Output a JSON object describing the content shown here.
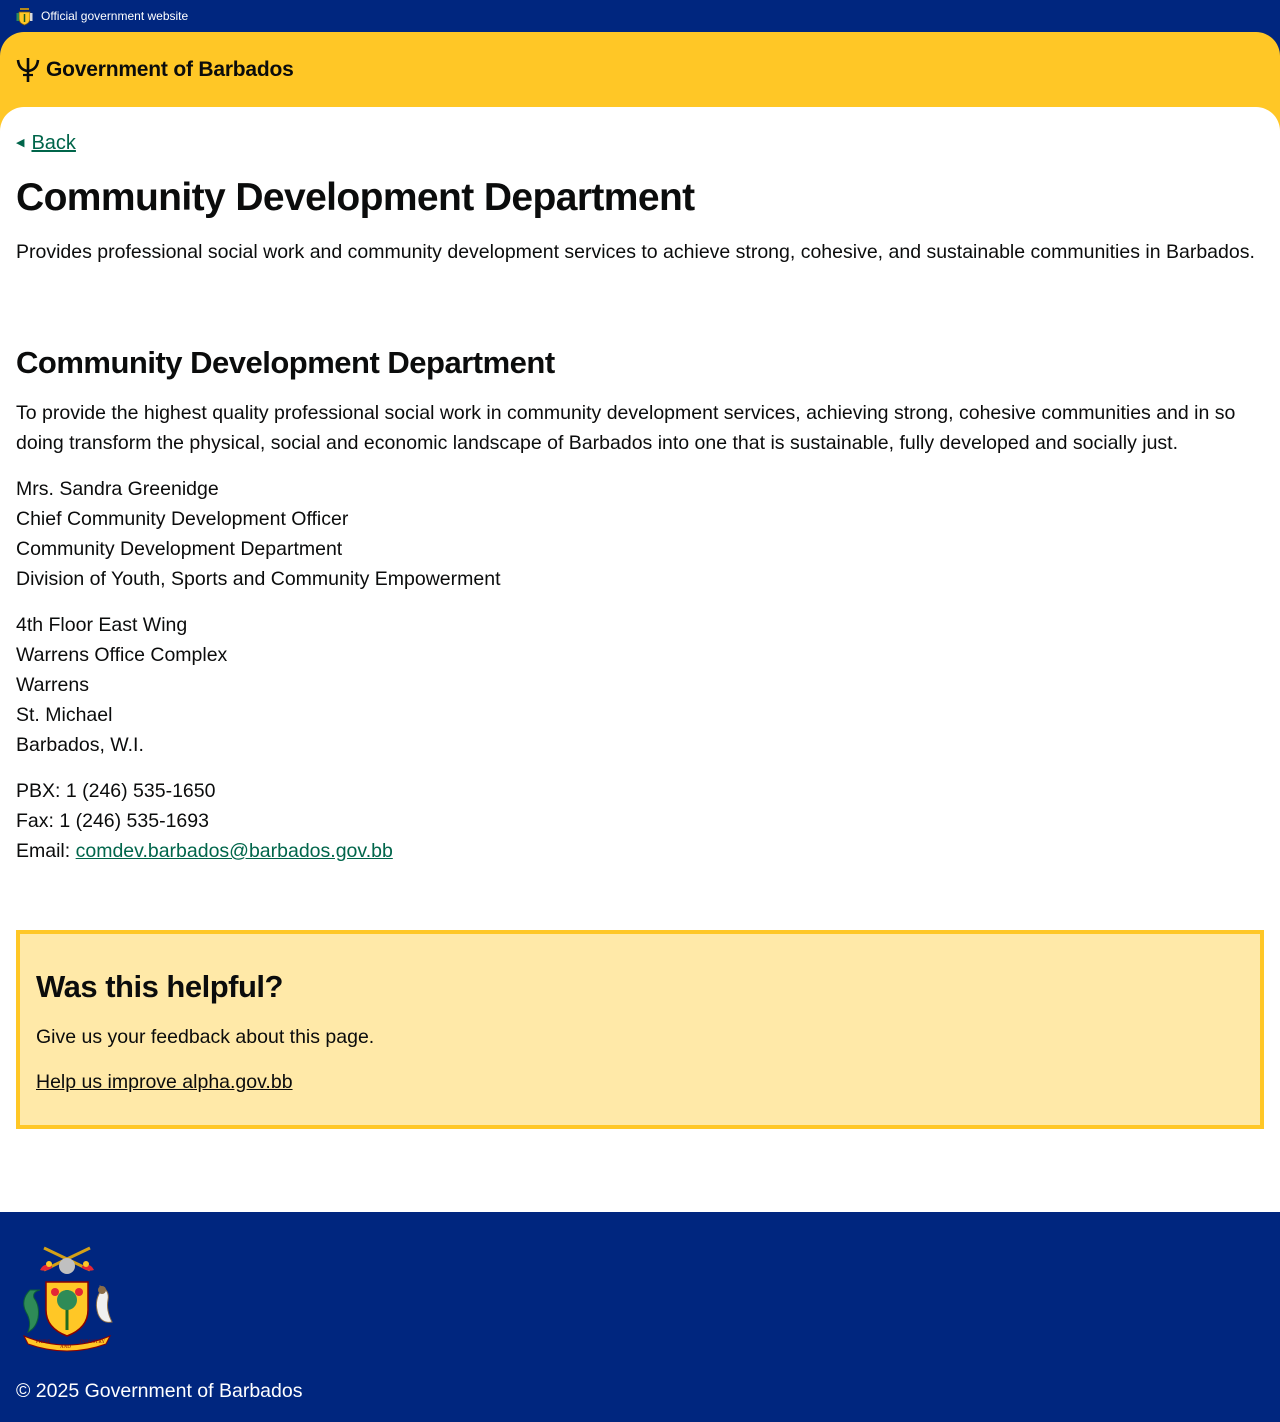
{
  "banner": {
    "text": "Official government website",
    "crest_icon": "barbados-coat-of-arms-icon"
  },
  "header": {
    "site_name": "Government of Barbados",
    "logo_icon": "trident-icon",
    "background": "#ffc726"
  },
  "nav": {
    "back_label": "Back",
    "back_icon": "arrow-left-icon"
  },
  "page": {
    "title": "Community Development Department",
    "lede": "Provides professional social work and community development services to achieve strong, cohesive, and sustainable communities in Barbados.",
    "section_title": "Community Development Department",
    "mission": "To provide the highest quality professional social work in community development services, achieving strong, cohesive communities and in so doing transform the physical, social and economic landscape of Barbados into one that is sustainable, fully developed and socially just.",
    "contact_lines": [
      "Mrs. Sandra Greenidge",
      "Chief Community Development Officer",
      "Community Development Department",
      "Division of Youth, Sports and Community Empowerment"
    ],
    "address_lines": [
      "4th Floor East Wing",
      "Warrens Office Complex",
      "Warrens",
      "St. Michael",
      "Barbados, W.I."
    ],
    "phone": "PBX: 1 (246) 535-1650",
    "fax": "Fax: 1 (246) 535-1693",
    "email_label": "Email:",
    "email": "comdev.barbados@barbados.gov.bb"
  },
  "feedback": {
    "title": "Was this helpful?",
    "text": "Give us your feedback about this page.",
    "link": "Help us improve alpha.gov.bb"
  },
  "footer": {
    "copyright": "© 2025 Government of Barbados",
    "crest_icon": "barbados-coat-of-arms-icon"
  },
  "colors": {
    "navy": "#00267f",
    "gold": "#ffc726",
    "link_green": "#00654a",
    "feedback_bg": "#ffe9a8"
  }
}
